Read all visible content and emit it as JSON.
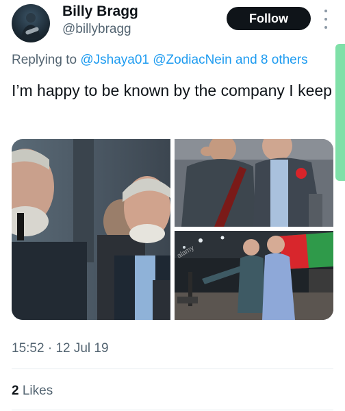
{
  "author": {
    "name": "Billy Bragg",
    "handle": "@billybragg",
    "avatar_icon": "avatar-photo-icon"
  },
  "follow_label": "Follow",
  "more_icon": "more-vertical-icon",
  "reply": {
    "prefix": "Replying to",
    "mention1": "@Jshaya01",
    "mention2": "@ZodiacNein",
    "others": "and 8 others"
  },
  "tweet_text": "I’m happy to be known by the company I keep",
  "media": {
    "watermark": "alamy"
  },
  "meta": {
    "time": "15:52",
    "separator": "·",
    "date": "12 Jul 19"
  },
  "likes": {
    "count": "2",
    "label": "Likes"
  },
  "colors": {
    "accent": "#1d9bf0",
    "text": "#0f1419",
    "secondary": "#536471",
    "follow_bg": "#0f1419"
  }
}
